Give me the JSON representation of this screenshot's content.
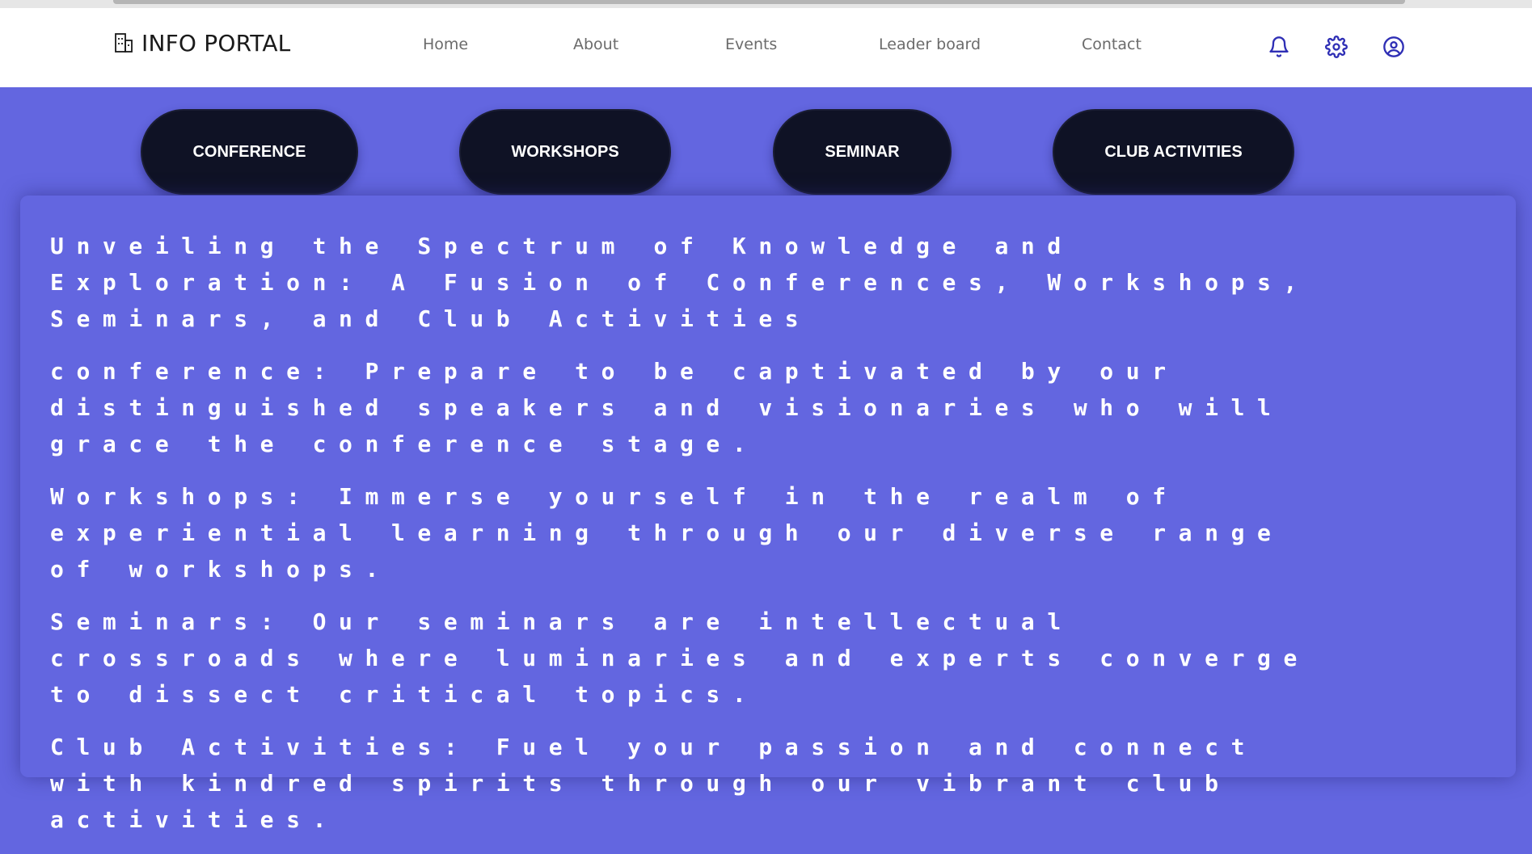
{
  "header": {
    "brand": "INFO PORTAL",
    "nav": [
      "Home",
      "About",
      "Events",
      "Leader board",
      "Contact"
    ],
    "icons": [
      "bell-icon",
      "gear-icon",
      "user-circle-icon"
    ]
  },
  "categories": [
    "CONFERENCE",
    "WORKSHOPS",
    "SEMINAR",
    "CLUB ACTIVITIES"
  ],
  "content": {
    "heading": "Unveiling the Spectrum of Knowledge and Exploration: A Fusion of Conferences, Workshops, Seminars, and Club Activities",
    "paragraphs": [
      "conference: Prepare to be captivated by our distinguished speakers and visionaries who will grace the conference stage.",
      "Workshops: Immerse yourself in the realm of experiential learning through our diverse range of workshops.",
      "Seminars: Our seminars are intellectual crossroads where luminaries and experts converge to dissect critical topics.",
      "Club Activities: Fuel your passion and connect with kindred spirits through our vibrant club activities."
    ]
  },
  "colors": {
    "background": "#6366e0",
    "pill": "#0f1225",
    "icon_accent": "#2f2fb5",
    "header_bg": "#ffffff"
  }
}
